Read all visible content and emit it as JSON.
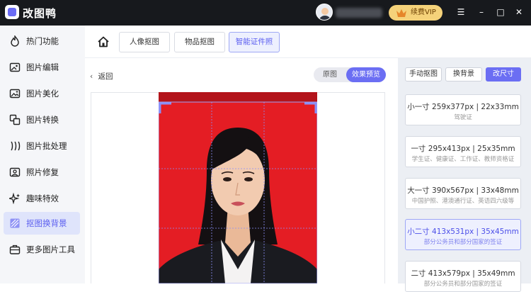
{
  "app": {
    "name": "改图鸭"
  },
  "vip": {
    "label": "续费VIP"
  },
  "window": {
    "minimize": "☰",
    "minus": "–",
    "maximize": "□",
    "close": "✕"
  },
  "sidebar": {
    "items": [
      {
        "label": "热门功能",
        "icon": "flame-icon"
      },
      {
        "label": "图片编辑",
        "icon": "image-edit-icon"
      },
      {
        "label": "图片美化",
        "icon": "image-beautify-icon"
      },
      {
        "label": "图片转换",
        "icon": "image-convert-icon"
      },
      {
        "label": "图片批处理",
        "icon": "batch-icon"
      },
      {
        "label": "照片修复",
        "icon": "photo-repair-icon"
      },
      {
        "label": "趣味特效",
        "icon": "sparkle-icon"
      },
      {
        "label": "抠图换背景",
        "icon": "cutout-icon"
      },
      {
        "label": "更多图片工具",
        "icon": "toolbox-icon"
      }
    ]
  },
  "tabs": [
    "人像抠图",
    "物品抠图",
    "智能证件照"
  ],
  "back": {
    "label": "返回"
  },
  "view_toggle": {
    "original": "原图",
    "preview": "效果预览"
  },
  "right": {
    "manual": "手动抠图",
    "change_bg": "换背景",
    "resize": "改尺寸"
  },
  "sizes": [
    {
      "title": "小一寸 259x377px | 22x33mm",
      "desc": "驾驶证"
    },
    {
      "title": "一寸 295x413px | 25x35mm",
      "desc": "学生证、健康证、工作证、教师资格证"
    },
    {
      "title": "大一寸 390x567px | 33x48mm",
      "desc": "中国护照、港澳通行证、英语四六级等"
    },
    {
      "title": "小二寸 413x531px | 35x45mm",
      "desc": "部分公务员和部分国家的签证"
    },
    {
      "title": "二寸 413x579px | 35x49mm",
      "desc": "部分公务员和部分国家的签证"
    }
  ],
  "colors": {
    "accent": "#6b6ef3",
    "photo_bg": "#e41d24",
    "titlebar": "#17191d",
    "vip": "#f5d27a"
  }
}
